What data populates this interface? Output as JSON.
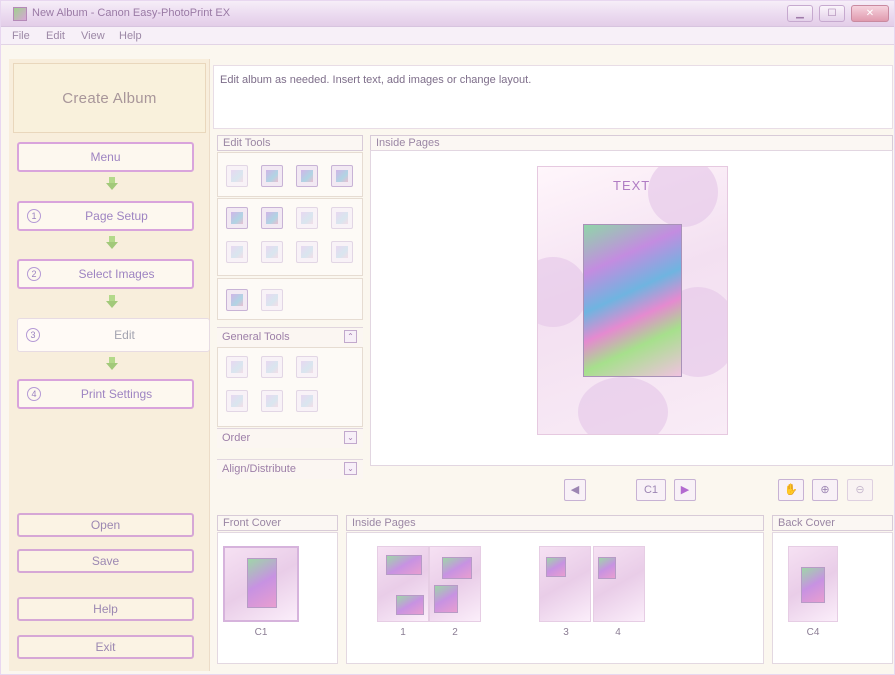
{
  "window": {
    "title": "New Album - Canon Easy-PhotoPrint EX",
    "controls": [
      "minimize-icon",
      "maximize-icon",
      "close-icon"
    ]
  },
  "menu": [
    "File",
    "Edit",
    "View",
    "Help"
  ],
  "sidebar": {
    "heading": "Create Album",
    "steps": [
      {
        "label": "Menu",
        "num": ""
      },
      {
        "label": "Page Setup",
        "num": "1"
      },
      {
        "label": "Select Images",
        "num": "2"
      },
      {
        "label": "Edit",
        "num": "3"
      },
      {
        "label": "Print Settings",
        "num": "4"
      }
    ],
    "bottom": [
      "Open",
      "Save",
      "Help",
      "Exit"
    ]
  },
  "instruction": "Edit album as needed. Insert text, add images or change layout.",
  "edit_tools": {
    "header": "Edit Tools",
    "general": "General Tools",
    "order": "Order",
    "align": "Align/Distribute"
  },
  "preview": {
    "header": "Inside Pages",
    "page_text": "TEXT",
    "current_page": "C1"
  },
  "thumbs": {
    "front_header": "Front Cover",
    "inside_header": "Inside Pages",
    "back_header": "Back Cover",
    "labels": [
      "C1",
      "1",
      "2",
      "3",
      "4",
      "C4"
    ]
  },
  "colors": {
    "accent": "#d9a4dc",
    "panel": "#f8eedc"
  }
}
